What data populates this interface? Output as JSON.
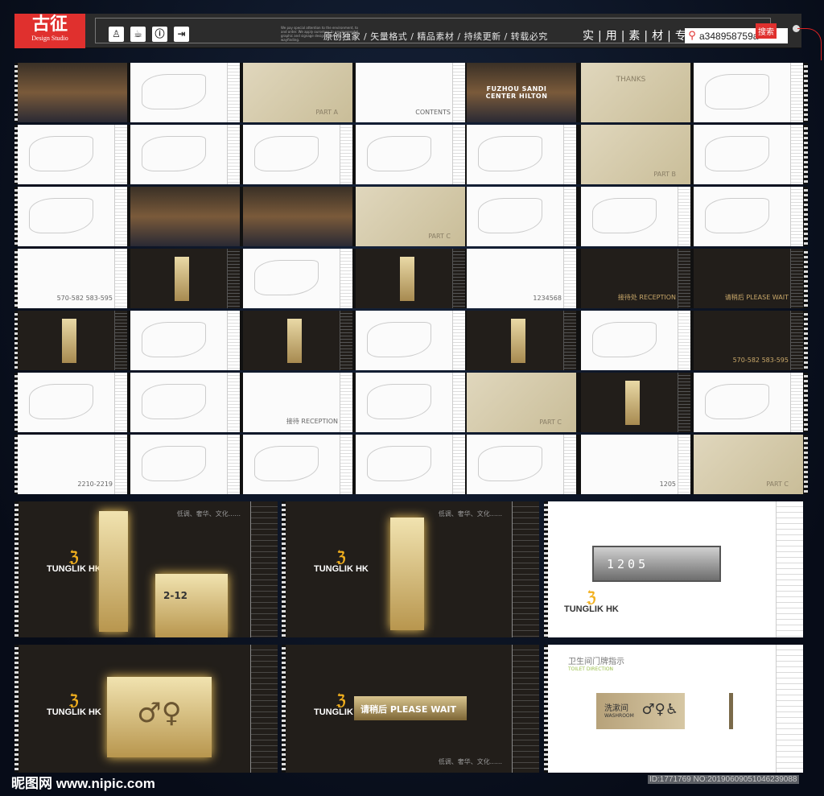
{
  "logo": {
    "mark": "古征",
    "sub": "Design Studio"
  },
  "header": {
    "icons": [
      "person-icon",
      "cup-icon",
      "info-icon",
      "exit-icon"
    ],
    "tagline": "We pay special attention to the environment, to and order. We apply ourselves to environmental graphic and signage design, planning, and wayfinding.",
    "slogan": "原创独家 / 矢量格式 / 精品素材 / 持续更新 / 转载必究",
    "expert": "实|用|素|材|专|家",
    "search_value": "a348958759a",
    "search_button": "搜索"
  },
  "rows": [
    [
      {
        "t": "p",
        "l": ""
      },
      {
        "t": "w",
        "l": ""
      },
      {
        "t": "b",
        "l": "PART A"
      },
      {
        "t": "w",
        "l": "CONTENTS"
      },
      {
        "t": "p",
        "l": "FUZHOU SANDI CENTER HILTON"
      },
      {
        "t": "b",
        "l": "THANKS",
        "c": 1
      },
      {
        "t": "w",
        "l": ""
      }
    ],
    [
      {
        "t": "w",
        "l": ""
      },
      {
        "t": "w",
        "l": ""
      },
      {
        "t": "w",
        "l": ""
      },
      {
        "t": "w",
        "l": ""
      },
      {
        "t": "w",
        "l": ""
      },
      {
        "t": "b",
        "l": "PART B"
      },
      {
        "t": "w",
        "l": ""
      }
    ],
    [
      {
        "t": "w",
        "l": ""
      },
      {
        "t": "p",
        "l": ""
      },
      {
        "t": "p",
        "l": ""
      },
      {
        "t": "b",
        "l": "PART C"
      },
      {
        "t": "w",
        "l": ""
      },
      {
        "t": "w",
        "l": ""
      },
      {
        "t": "w",
        "l": ""
      }
    ],
    [
      {
        "t": "w",
        "l": "570-582  583-595"
      },
      {
        "t": "d",
        "l": ""
      },
      {
        "t": "w",
        "l": ""
      },
      {
        "t": "d",
        "l": ""
      },
      {
        "t": "w",
        "l": "1234568"
      },
      {
        "t": "d",
        "l": "接待处 RECEPTION"
      },
      {
        "t": "d",
        "l": "请稍后 PLEASE WAIT"
      }
    ],
    [
      {
        "t": "d",
        "l": ""
      },
      {
        "t": "w",
        "l": ""
      },
      {
        "t": "d",
        "l": ""
      },
      {
        "t": "w",
        "l": ""
      },
      {
        "t": "d",
        "l": ""
      },
      {
        "t": "w",
        "l": ""
      },
      {
        "t": "d",
        "l": "570-582  583-595"
      }
    ],
    [
      {
        "t": "w",
        "l": ""
      },
      {
        "t": "w",
        "l": ""
      },
      {
        "t": "w",
        "l": "接待 RECEPTION"
      },
      {
        "t": "w",
        "l": ""
      },
      {
        "t": "b",
        "l": "PART C"
      },
      {
        "t": "d",
        "l": ""
      },
      {
        "t": "w",
        "l": ""
      }
    ],
    [
      {
        "t": "w",
        "l": "2210-2219"
      },
      {
        "t": "w",
        "l": ""
      },
      {
        "t": "w",
        "l": ""
      },
      {
        "t": "w",
        "l": ""
      },
      {
        "t": "w",
        "l": ""
      },
      {
        "t": "w",
        "l": "1205"
      },
      {
        "t": "b",
        "l": "PART C"
      }
    ]
  ],
  "panels": {
    "motto": "低调、奢华、文化......",
    "brand": "TUNGLIK HK",
    "room": "2-12",
    "plate": "1205",
    "wait": "请稍后 PLEASE WAIT",
    "toilet_title": "卫生间门牌指示",
    "toilet_en": "TOILET DIRECTION",
    "wash_cn": "洗漱间",
    "wash_en": "WASHROOM"
  },
  "watermark": {
    "site": "昵图网 www.nipic.com",
    "id": "ID:1771769 NO:20190609051046239088"
  }
}
